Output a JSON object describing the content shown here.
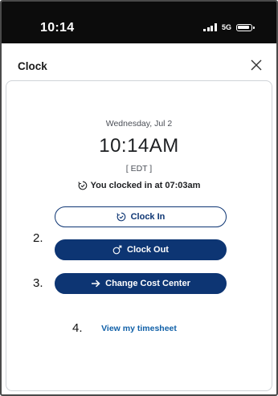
{
  "status_bar": {
    "time": "10:14",
    "network": "5G",
    "signal_icon": "signal-bars-icon",
    "battery_icon": "battery-icon"
  },
  "header": {
    "title": "Clock",
    "close_icon": "close-icon"
  },
  "clock_panel": {
    "date": "Wednesday, Jul 2",
    "time": "10:14AM",
    "timezone": "[ EDT ]",
    "clocked_in_status": "You clocked in at 07:03am",
    "status_icon": "clock-check-icon"
  },
  "actions": {
    "clock_in_label": "Clock In",
    "clock_in_icon": "clock-check-icon",
    "clock_out_label": "Clock Out",
    "clock_out_icon": "clock-arrow-out-icon",
    "change_cost_center_label": "Change Cost Center",
    "change_cost_center_icon": "arrow-right-icon",
    "view_timesheet_label": "View my timesheet"
  },
  "annotations": {
    "marker_2": "2.",
    "marker_3": "3.",
    "marker_4": "4."
  },
  "colors": {
    "primary": "#0d3573",
    "link": "#1060a8",
    "status_bar": "#0c0c0c"
  }
}
